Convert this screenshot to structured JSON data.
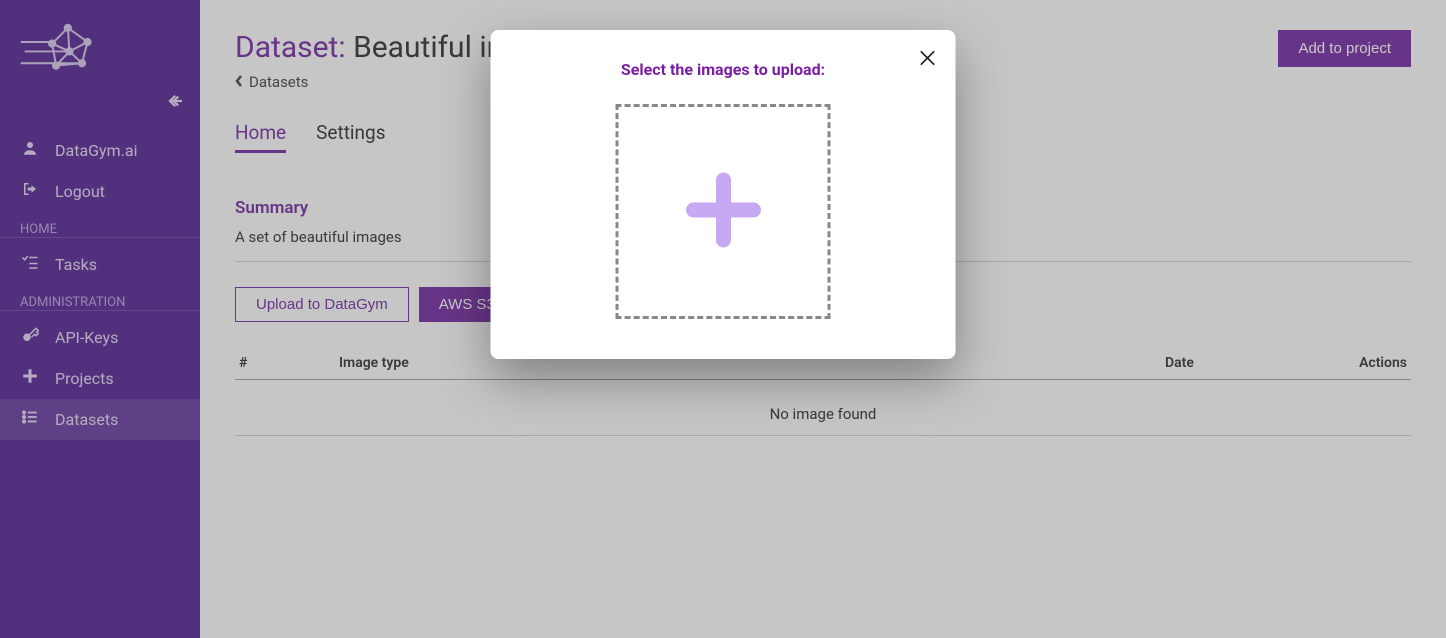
{
  "sidebar": {
    "user_label": "DataGym.ai",
    "logout_label": "Logout",
    "section_home": "HOME",
    "section_admin": "ADMINISTRATION",
    "items": {
      "tasks": "Tasks",
      "apikeys": "API-Keys",
      "projects": "Projects",
      "datasets": "Datasets"
    }
  },
  "header": {
    "title_prefix": "Dataset: ",
    "title_name": "Beautiful images",
    "breadcrumb": "Datasets",
    "add_to_project": "Add to project"
  },
  "tabs": {
    "home": "Home",
    "settings": "Settings"
  },
  "summary": {
    "heading": "Summary",
    "text": "A set of beautiful images"
  },
  "buttons": {
    "upload": "Upload to DataGym",
    "aws": "AWS S3"
  },
  "table": {
    "col_index": "#",
    "col_type": "Image type",
    "col_name": "",
    "col_date": "Date",
    "col_actions": "Actions",
    "empty": "No image found"
  },
  "modal": {
    "title": "Select the images to upload:"
  }
}
